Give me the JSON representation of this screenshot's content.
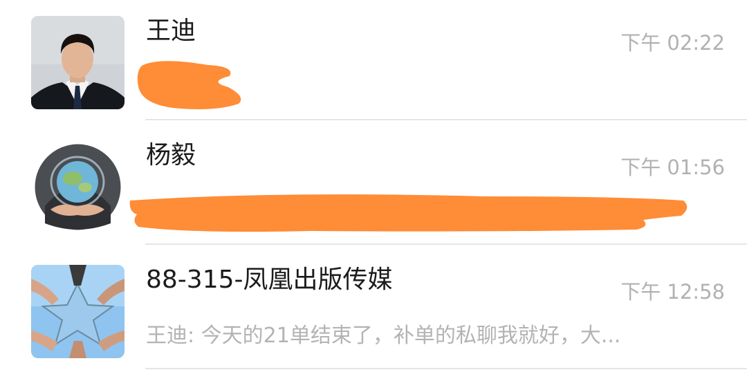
{
  "conversations": [
    {
      "name": "王迪",
      "time": "下午 02:22",
      "preview": "",
      "preview_redacted": true,
      "avatar": "man-in-suit-photo"
    },
    {
      "name": "杨毅",
      "time": "下午 01:56",
      "preview": "",
      "preview_redacted": true,
      "avatar": "hands-holding-globe-photo"
    },
    {
      "name": "88-315-凤凰出版传媒",
      "time": "下午 12:58",
      "preview": "王迪: 今天的21单结束了，补单的私聊我就好，大...",
      "preview_redacted": false,
      "avatar": "hands-star-sky-photo"
    }
  ],
  "colors": {
    "redaction": "#ff8c36",
    "name_text": "#1b1b1b",
    "meta_text": "#b1b1b1",
    "divider": "#e5e5e5"
  }
}
